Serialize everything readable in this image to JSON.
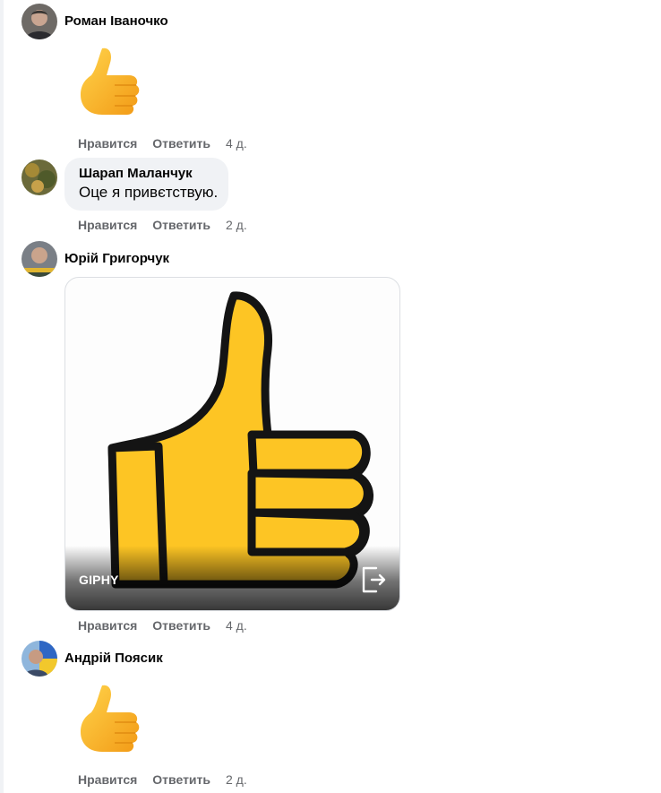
{
  "actions": {
    "like_label": "Нравится",
    "reply_label": "Ответить"
  },
  "comments": [
    {
      "author": "Роман Іваночко",
      "time": "4 д.",
      "attachment": "thumbs-up-emoji"
    },
    {
      "author": "Шарап Маланчук",
      "text": "Оце я привєтствую.",
      "time": "2 д."
    },
    {
      "author": "Юрій Григорчук",
      "time": "4 д.",
      "attachment": "gif",
      "gif_badge": "GIPHY"
    },
    {
      "author": "Андрій Поясик",
      "time": "2 д.",
      "attachment": "thumbs-up-emoji"
    }
  ],
  "colors": {
    "meta_text": "#65676b",
    "bubble_bg": "#f0f2f5",
    "emoji_yellow": "#fbb92c"
  }
}
